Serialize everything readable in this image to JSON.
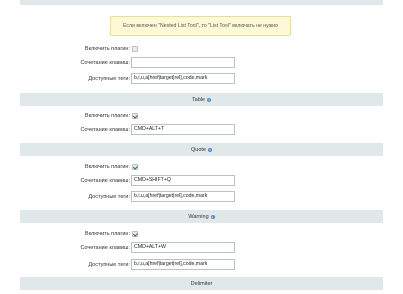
{
  "notice": "Если включен \"Nested List Tool\", то \"List Tool\" включать не нужно",
  "groups": [
    {
      "title": null,
      "rows": [
        {
          "label": "Включить плагин:",
          "type": "checkbox",
          "checked": false
        },
        {
          "label": "Сочетание клавиш:",
          "type": "input",
          "value": ""
        },
        {
          "label": "Доступные теги:",
          "type": "input",
          "value": "b,i,u,a[href|target|rel],code,mark"
        }
      ]
    },
    {
      "title": "Table",
      "rows": [
        {
          "label": "Включить плагин:",
          "type": "checkbox",
          "checked": true
        },
        {
          "label": "Сочетание клавиш:",
          "type": "input",
          "value": "CMD+ALT+T"
        }
      ]
    },
    {
      "title": "Quote",
      "rows": [
        {
          "label": "Включить плагин:",
          "type": "checkbox",
          "checked": true
        },
        {
          "label": "Сочетание клавиш:",
          "type": "input",
          "value": "CMD+SHIFT+Q"
        },
        {
          "label": "Доступные теги:",
          "type": "input",
          "value": "b,i,u,a[href|target|rel],code,mark"
        }
      ]
    },
    {
      "title": "Warning",
      "rows": [
        {
          "label": "Включить плагин:",
          "type": "checkbox",
          "checked": true
        },
        {
          "label": "Сочетание клавиш:",
          "type": "input",
          "value": "CMD+ALT+W"
        },
        {
          "label": "Доступные теги:",
          "type": "input",
          "value": "b,i,u,a[href|target|rel],code,mark"
        }
      ]
    },
    {
      "title": "Delimiter",
      "rows": []
    }
  ],
  "icons": {
    "info": "info-icon"
  },
  "colors": {
    "section_bg": "#e1e8ea",
    "notice_bg": "#fdf8d6",
    "info_icon": "#4f8ed6"
  }
}
